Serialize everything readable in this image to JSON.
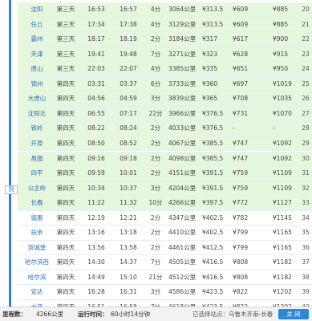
{
  "rows": [
    {
      "station": "沈阳",
      "day": "第三天",
      "arrive": "16:53",
      "depart": "16:57",
      "stop": "4分",
      "distance": "3064公里",
      "price1": "¥313.5",
      "price2": "¥609",
      "price3": "¥885",
      "no": "20",
      "bg": "green"
    },
    {
      "station": "任丘",
      "day": "第三天",
      "arrive": "17:34",
      "depart": "17:38",
      "stop": "4分",
      "distance": "3129公里",
      "price1": "¥313.5",
      "price2": "¥609",
      "price3": "¥885",
      "no": "21",
      "bg": "green"
    },
    {
      "station": "霸州",
      "day": "第三天",
      "arrive": "18:17",
      "depart": "18:19",
      "stop": "2分",
      "distance": "3184公里",
      "price1": "¥317",
      "price2": "¥617",
      "price3": "¥900",
      "no": "22",
      "bg": "green"
    },
    {
      "station": "天津",
      "day": "第三天",
      "arrive": "19:41",
      "depart": "19:48",
      "stop": "7分",
      "distance": "3271公里",
      "price1": "¥323",
      "price2": "¥628",
      "price3": "¥915",
      "no": "23",
      "bg": "green"
    },
    {
      "station": "唐山",
      "day": "第三天",
      "arrive": "22:03",
      "depart": "22:07",
      "stop": "4分",
      "distance": "3385公里",
      "price1": "¥335",
      "price2": "¥651",
      "price3": "¥950",
      "no": "24",
      "bg": "green"
    },
    {
      "station": "锦州",
      "day": "第四天",
      "arrive": "03:31",
      "depart": "03:37",
      "stop": "6分",
      "distance": "3733公里",
      "price1": "¥360",
      "price2": "¥697",
      "price3": "¥1019",
      "no": "25",
      "bg": "green"
    },
    {
      "station": "大虎山",
      "day": "第四天",
      "arrive": "04:56",
      "depart": "04:59",
      "stop": "3分",
      "distance": "3839公里",
      "price1": "¥365",
      "price2": "¥708",
      "price3": "¥1035",
      "no": "26",
      "bg": "green"
    },
    {
      "station": "沈阳北",
      "day": "第四天",
      "arrive": "06:55",
      "depart": "07:17",
      "stop": "22分",
      "distance": "3966公里",
      "price1": "¥376.5",
      "price2": "¥731",
      "price3": "¥1070",
      "no": "27",
      "bg": "green"
    },
    {
      "station": "铁岭",
      "day": "第四天",
      "arrive": "08:22",
      "depart": "08:24",
      "stop": "2分",
      "distance": "4033公里",
      "price1": "¥376.5",
      "price2": "-",
      "price3": "-",
      "no": "28",
      "bg": "green"
    },
    {
      "station": "开原",
      "day": "第四天",
      "arrive": "08:50",
      "depart": "08:52",
      "stop": "2分",
      "distance": "4067公里",
      "price1": "¥385.5",
      "price2": "¥747",
      "price3": "¥1092",
      "no": "29",
      "bg": "green"
    },
    {
      "station": "昌图",
      "day": "第四天",
      "arrive": "09:16",
      "depart": "09:18",
      "stop": "2分",
      "distance": "4098公里",
      "price1": "¥385.5",
      "price2": "¥747",
      "price3": "¥1092",
      "no": "30",
      "bg": "green"
    },
    {
      "station": "四平",
      "day": "第四天",
      "arrive": "09:59",
      "depart": "10:01",
      "stop": "2分",
      "distance": "4151公里",
      "price1": "¥391.5",
      "price2": "¥759",
      "price3": "¥1109",
      "no": "31",
      "bg": "green"
    },
    {
      "station": "公主岭",
      "day": "第四天",
      "arrive": "10:34",
      "depart": "10:37",
      "stop": "3分",
      "distance": "4204公里",
      "price1": "¥391.5",
      "price2": "¥759",
      "price3": "¥1109",
      "no": "32",
      "bg": "green"
    },
    {
      "station": "长春",
      "day": "第四天",
      "arrive": "11:22",
      "depart": "11:32",
      "stop": "10分",
      "distance": "4266公里",
      "price1": "¥397.5",
      "price2": "¥772",
      "price3": "¥1127",
      "no": "33",
      "bg": "green"
    },
    {
      "station": "德惠",
      "day": "第四天",
      "arrive": "12:19",
      "depart": "12:21",
      "stop": "2分",
      "distance": "4347公里",
      "price1": "¥402.5",
      "price2": "¥782",
      "price3": "¥1145",
      "no": "34",
      "bg": "white"
    },
    {
      "station": "扶余",
      "day": "第四天",
      "arrive": "13:16",
      "depart": "13:18",
      "stop": "2分",
      "distance": "4410公里",
      "price1": "¥402.5",
      "price2": "¥799",
      "price3": "¥1165",
      "no": "35",
      "bg": "white"
    },
    {
      "station": "双城堡",
      "day": "第四天",
      "arrive": "13:56",
      "depart": "13:58",
      "stop": "2分",
      "distance": "4461公里",
      "price1": "¥412.5",
      "price2": "¥799",
      "price3": "¥1165",
      "no": "36",
      "bg": "white"
    },
    {
      "station": "哈尔滨西",
      "day": "第四天",
      "arrive": "14:30",
      "depart": "14:37",
      "stop": "7分",
      "distance": "4505公里",
      "price1": "¥416.5",
      "price2": "¥808",
      "price3": "¥1182",
      "no": "37",
      "bg": "white"
    },
    {
      "station": "哈尔滨",
      "day": "第四天",
      "arrive": "14:49",
      "depart": "15:10",
      "stop": "21分",
      "distance": "4512公里",
      "price1": "¥416.5",
      "price2": "¥808",
      "price3": "¥1182",
      "no": "38",
      "bg": "white"
    },
    {
      "station": "安达",
      "day": "第四天",
      "arrive": "16:28",
      "depart": "16:31",
      "stop": "3分",
      "distance": "4586公里",
      "price1": "¥423.5",
      "price2": "¥822",
      "price3": "¥1202",
      "no": "39",
      "bg": "white"
    },
    {
      "station": "大庆",
      "day": "第四天",
      "arrive": "16:51",
      "depart": "16:58",
      "stop": "7分",
      "distance": "4618公里",
      "price1": "¥423.5",
      "price2": "¥822",
      "price3": "¥1202",
      "no": "40",
      "bg": "white"
    },
    {
      "station": "齐齐哈尔",
      "day": "第四天",
      "arrive": "18:40",
      "depart": "终到站",
      "stop": "-",
      "distance": "4685公里",
      "price1": "¥439",
      "price2": "¥850",
      "price3": "¥1244",
      "no": "41",
      "bg": "white"
    }
  ],
  "arrive_tag": "到",
  "footer": {
    "distance_label": "里程数：",
    "distance_value": "4266公里",
    "time_label": "运行时间：",
    "time_value": "60小时14分钟",
    "selected": "已选择站点：乌鲁木齐南-长春",
    "close_button": "关 闭"
  },
  "colors": {
    "row_highlight": "#e5f7dd",
    "timeline": "#2f7fd0",
    "button": "#2f86d6"
  }
}
